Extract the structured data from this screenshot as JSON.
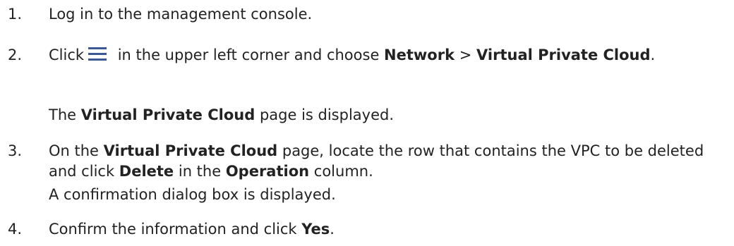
{
  "steps": [
    {
      "number": "1.",
      "parts": {
        "text1": "Log in to the management console."
      }
    },
    {
      "number": "2.",
      "parts": {
        "text1": "Click",
        "icon": "menu-icon",
        "text2": " in the upper left corner and choose ",
        "bold1": "Network",
        "text3": " > ",
        "bold2": "Virtual Private Cloud",
        "text4": "."
      },
      "result": {
        "text1": "The ",
        "bold1": "Virtual Private Cloud",
        "text2": " page is displayed."
      }
    },
    {
      "number": "3.",
      "parts": {
        "text1": "On the ",
        "bold1": "Virtual Private Cloud",
        "text2": " page, locate the row that contains the VPC to be deleted and click ",
        "bold2": "Delete",
        "text3": " in the ",
        "bold3": "Operation",
        "text4": " column."
      },
      "result": {
        "text1": "A confirmation dialog box is displayed."
      }
    },
    {
      "number": "4.",
      "parts": {
        "text1": "Confirm the information and click ",
        "bold1": "Yes",
        "text2": "."
      }
    }
  ],
  "colors": {
    "text": "#222222",
    "background": "#ffffff",
    "icon": "#3a5896"
  }
}
